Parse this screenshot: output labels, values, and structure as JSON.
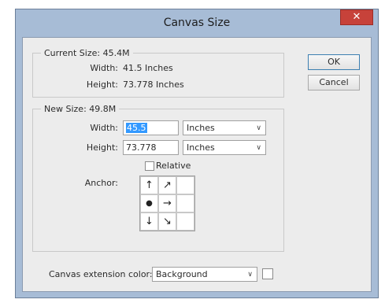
{
  "window": {
    "title": "Canvas Size",
    "close_icon": "close-icon"
  },
  "current_size": {
    "legend": "Current Size: 45.4M",
    "width_label": "Width:",
    "width_value": "41.5 Inches",
    "height_label": "Height:",
    "height_value": "73.778 Inches"
  },
  "new_size": {
    "legend": "New Size: 49.8M",
    "width_label": "Width:",
    "width_value": "45.5",
    "width_unit": "Inches",
    "height_label": "Height:",
    "height_value": "73.778",
    "height_unit": "Inches",
    "relative_label": "Relative",
    "relative_checked": false,
    "anchor_label": "Anchor:",
    "anchor_cells": [
      "↑",
      "↗",
      "",
      "●",
      "→",
      "",
      "↓",
      "↘",
      ""
    ]
  },
  "buttons": {
    "ok": "OK",
    "cancel": "Cancel"
  },
  "extension": {
    "label": "Canvas extension color:",
    "value": "Background"
  },
  "colors": {
    "window_frame": "#a7bcd6",
    "close_button": "#c7423a",
    "selection": "#3399ff"
  }
}
